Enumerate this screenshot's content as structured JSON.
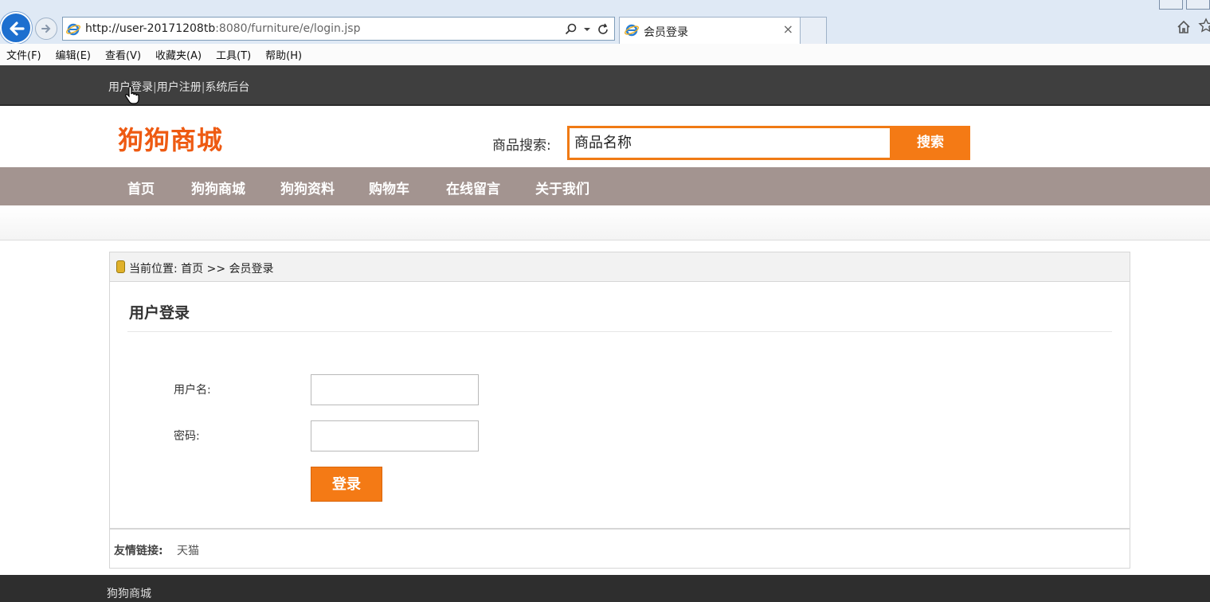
{
  "browser": {
    "url_prefix": "http://user-20171208tb",
    "url_suffix": ":8080/furniture/e/login.jsp",
    "tab_title": "会员登录",
    "tab_close": "×",
    "search_icon": "search-icon",
    "refresh_icon": "refresh-icon"
  },
  "menu": [
    "文件(F)",
    "编辑(E)",
    "查看(V)",
    "收藏夹(A)",
    "工具(T)",
    "帮助(H)"
  ],
  "top_links": [
    "用户登录",
    "用户注册",
    "系统后台"
  ],
  "top_links_separator": "|",
  "header": {
    "logo": "狗狗商城",
    "search_label": "商品搜索:",
    "search_value": "商品名称",
    "search_button": "搜索"
  },
  "nav": [
    "首页",
    "狗狗商城",
    "狗狗资料",
    "购物车",
    "在线留言",
    "关于我们"
  ],
  "breadcrumb": "当前位置: 首页 >> 会员登录",
  "login": {
    "title": "用户登录",
    "username_label": "用户名:",
    "password_label": "密码:",
    "username_value": "",
    "password_value": "",
    "submit": "登录"
  },
  "friend_links": {
    "label": "友情链接:",
    "items": [
      "天猫"
    ]
  },
  "footer": "狗狗商城",
  "colors": {
    "accent": "#f47a15",
    "logo": "#ee5a12",
    "nav_bg": "#a39490",
    "top_bg": "#3f3f3f"
  }
}
